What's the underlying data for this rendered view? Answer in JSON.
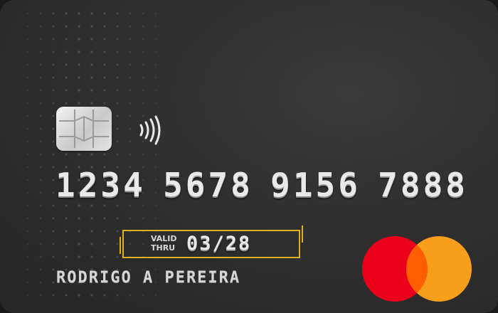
{
  "card": {
    "number_groups": [
      "1234",
      "5678",
      "9156",
      "7888"
    ],
    "valid_label_line1": "VALID",
    "valid_label_line2": "THRU",
    "expiry": "03/28",
    "holder_name": "RODRIGO A PEREIRA",
    "network": "mastercard-logo"
  },
  "colors": {
    "card_background": "#2f2f2f",
    "highlight_box": "#e0b021",
    "mastercard_red": "#eb001b",
    "mastercard_orange": "#f79e1b",
    "mastercard_overlap": "#ff5f00"
  },
  "icons": {
    "chip": "emv-chip-icon",
    "contactless": "contactless-icon"
  }
}
